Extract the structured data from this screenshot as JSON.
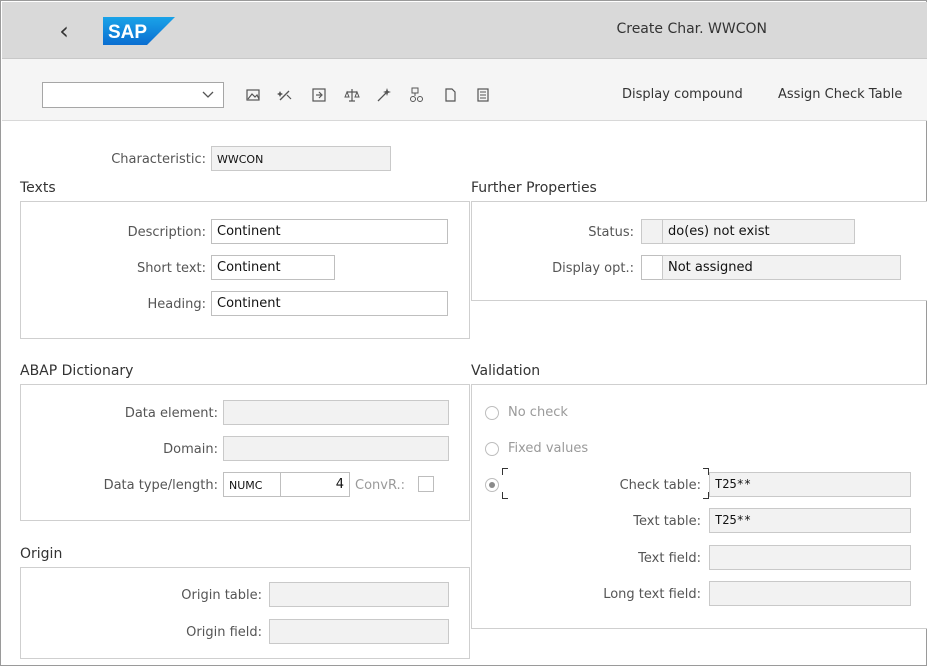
{
  "header": {
    "title": "Create Char. WWCON",
    "logo_text": "SAP"
  },
  "toolbar": {
    "dropdown_value": "",
    "icons": [
      "image-icon",
      "magic-wand-icon",
      "import-icon",
      "balance-scale-icon",
      "sparkle-wand-icon",
      "hierarchy-link-icon",
      "blank-page-icon",
      "document-list-icon"
    ],
    "display_compound_label": "Display compound",
    "assign_check_table_label": "Assign Check Table"
  },
  "characteristic": {
    "label": "Characteristic:",
    "value": "WWCON"
  },
  "texts": {
    "section_title": "Texts",
    "description_label": "Description:",
    "description_value": "Continent",
    "short_text_label": "Short text:",
    "short_text_value": "Continent",
    "heading_label": "Heading:",
    "heading_value": "Continent"
  },
  "further_properties": {
    "section_title": "Further Properties",
    "status_label": "Status:",
    "status_code": "",
    "status_value": "do(es) not exist",
    "display_opt_label": "Display opt.:",
    "display_opt_code": "",
    "display_opt_value": "Not assigned"
  },
  "abap_dictionary": {
    "section_title": "ABAP Dictionary",
    "data_element_label": "Data element:",
    "data_element_value": "",
    "domain_label": "Domain:",
    "domain_value": "",
    "data_type_label": "Data type/length:",
    "data_type_value": "NUMC",
    "length_value": "4",
    "convr_label": "ConvR.:"
  },
  "validation": {
    "section_title": "Validation",
    "no_check_label": "No check",
    "fixed_values_label": "Fixed values",
    "selected_option": "check-table",
    "check_table_label": "Check table:",
    "check_table_value": "T25**",
    "text_table_label": "Text table:",
    "text_table_value": "T25**",
    "text_field_label": "Text field:",
    "text_field_value": "",
    "long_text_field_label": "Long text field:",
    "long_text_field_value": ""
  },
  "origin": {
    "section_title": "Origin",
    "origin_table_label": "Origin table:",
    "origin_table_value": "",
    "origin_field_label": "Origin field:",
    "origin_field_value": ""
  }
}
